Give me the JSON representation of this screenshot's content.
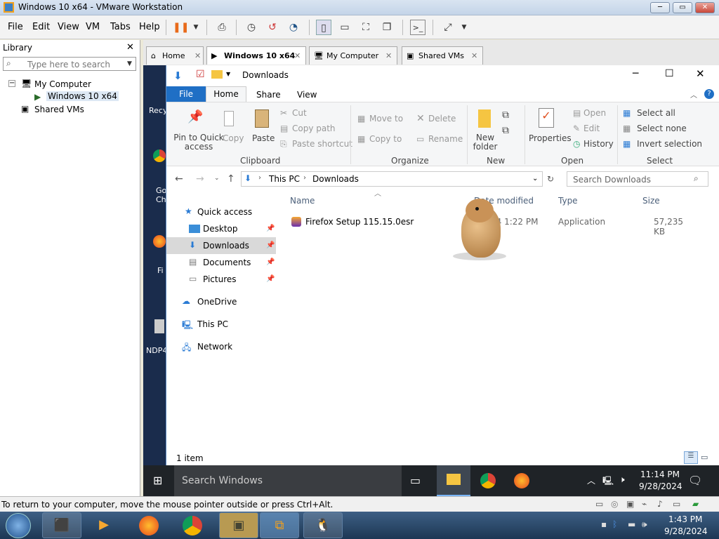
{
  "vmware": {
    "title": "Windows 10 x64 - VMware Workstation",
    "menu": [
      "File",
      "Edit",
      "View",
      "VM",
      "Tabs",
      "Help"
    ],
    "min": "─",
    "max": "▭",
    "close": "✕"
  },
  "library": {
    "title": "Library",
    "close": "✕",
    "search_placeholder": "Type here to search",
    "items": [
      "My Computer",
      "Windows 10 x64",
      "Shared VMs"
    ]
  },
  "tabs": [
    {
      "label": "Home"
    },
    {
      "label": "Windows 10 x64"
    },
    {
      "label": "My Computer"
    },
    {
      "label": "Shared VMs"
    }
  ],
  "tab_close": "✕",
  "desktop": {
    "icons": [
      "Recy",
      "Go Ch",
      "Fi",
      "NDP4"
    ]
  },
  "explorer": {
    "title": "Downloads",
    "ribbon_tabs": [
      "File",
      "Home",
      "Share",
      "View"
    ],
    "clipboard": {
      "pin": "Pin to Quick access",
      "copy": "Copy",
      "paste": "Paste",
      "cut": "Cut",
      "copy_path": "Copy path",
      "paste_shortcut": "Paste shortcut",
      "group": "Clipboard"
    },
    "organize": {
      "move_to": "Move to",
      "copy_to": "Copy to",
      "delete": "Delete",
      "rename": "Rename",
      "group": "Organize"
    },
    "new": {
      "new_folder": "New folder",
      "group": "New"
    },
    "open": {
      "properties": "Properties",
      "open": "Open",
      "edit": "Edit",
      "history": "History",
      "group": "Open"
    },
    "select": {
      "select_all": "Select all",
      "select_none": "Select none",
      "invert": "Invert selection",
      "group": "Select"
    },
    "path": [
      "This PC",
      "Downloads"
    ],
    "search_placeholder": "Search Downloads",
    "nav": [
      "Quick access",
      "Desktop",
      "Downloads",
      "Documents",
      "Pictures",
      "OneDrive",
      "This PC",
      "Network"
    ],
    "columns": [
      "Name",
      "Date modified",
      "Type",
      "Size"
    ],
    "files": [
      {
        "name": "Firefox Setup 115.15.0esr",
        "date": "24 1:22 PM",
        "type": "Application",
        "size": "57,235 KB"
      }
    ],
    "status": "1 item"
  },
  "guest_taskbar": {
    "search": "Search Windows",
    "time": "11:14 PM",
    "date": "9/28/2024"
  },
  "status_message": "To return to your computer, move the mouse pointer outside or press Ctrl+Alt.",
  "host_taskbar": {
    "time": "1:43 PM",
    "date": "9/28/2024"
  }
}
